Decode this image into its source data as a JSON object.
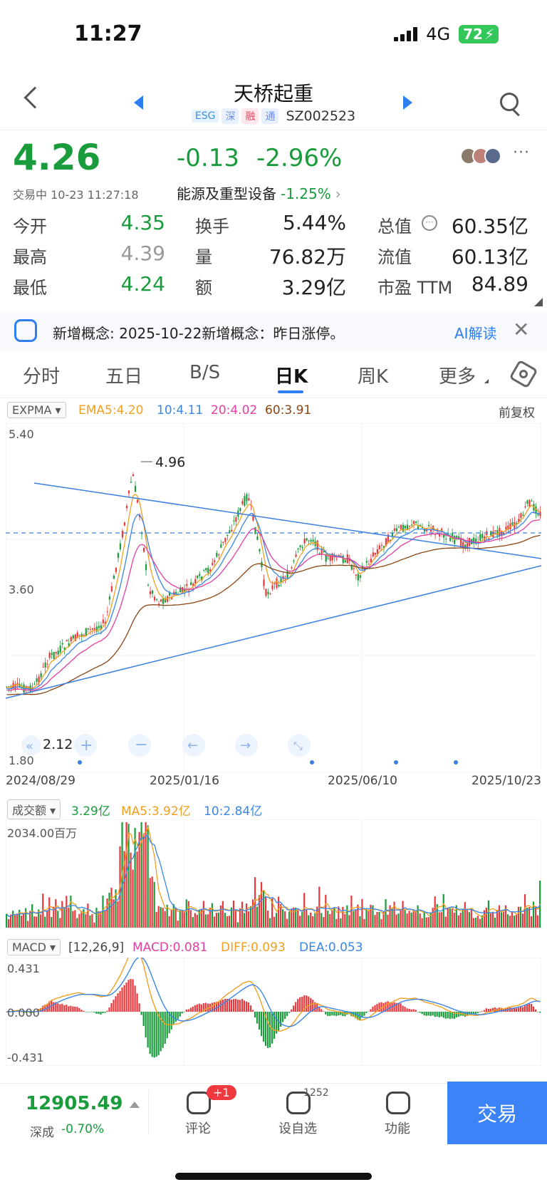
{
  "status_bar": {
    "time": "11:27",
    "network": "4G",
    "battery": "72"
  },
  "header": {
    "title": "天桥起重",
    "tags": [
      "ESG",
      "深",
      "融",
      "通"
    ],
    "code": "SZ002523"
  },
  "quote": {
    "price": "4.26",
    "change": "-0.13",
    "change_pct": "-2.96%",
    "trade_status": "交易中 10-23 11:27:18",
    "industry": "能源及重型设备",
    "industry_pct": "-1.25%",
    "more": "···",
    "stats": {
      "open_label": "今开",
      "open": "4.35",
      "high_label": "最高",
      "high": "4.39",
      "low_label": "最低",
      "low": "4.24",
      "turnover_label": "换手",
      "turnover": "5.44%",
      "volume_label": "量",
      "volume": "76.82万",
      "amount_label": "额",
      "amount": "3.29亿",
      "total_cap_label": "总值",
      "total_cap": "60.35亿",
      "float_cap_label": "流值",
      "float_cap": "60.13亿",
      "pe_label": "市盈 TTM",
      "pe": "84.89"
    }
  },
  "concept": {
    "text": "新增概念: 2025-10-22新增概念：昨日涨停。",
    "ai_label": "AI解读"
  },
  "tabs": [
    "分时",
    "五日",
    "B/S",
    "日K",
    "周K",
    "更多"
  ],
  "active_tab": "日K",
  "kline": {
    "indicator": "EXPMA",
    "ema5": "EMA5:4.20",
    "ema10": "10:4.11",
    "ema20": "20:4.02",
    "ema60": "60:3.91",
    "adjust": "前复权",
    "y_top": "5.40",
    "y_mid": "3.60",
    "y_bottom": "1.80",
    "max_label": "4.96",
    "min_label": "2.12",
    "dates": [
      "2024/08/29",
      "2025/01/16",
      "2025/06/10",
      "2025/10/23"
    ]
  },
  "volume_panel": {
    "indicator": "成交额",
    "value": "3.29亿",
    "ma5": "MA5:3.92亿",
    "ma10": "10:2.84亿",
    "y_top": "2034.00百万"
  },
  "macd_panel": {
    "indicator": "MACD",
    "params": "[12,26,9]",
    "macd": "MACD:0.081",
    "diff": "DIFF:0.093",
    "dea": "DEA:0.053",
    "y_top": "0.431",
    "y_mid": "0.000",
    "y_bottom": "-0.431"
  },
  "bottom_bar": {
    "index_value": "12905.49",
    "index_name": "深成",
    "index_pct": "-0.70%",
    "comment_label": "评论",
    "comment_badge": "+1",
    "watch_label": "设自选",
    "watch_count": "1252",
    "func_label": "功能",
    "trade_label": "交易"
  },
  "colors": {
    "up": "#e8383d",
    "down": "#1a9b3c",
    "accent": "#2f7ff0",
    "ema5": "#f0a020",
    "ema10": "#3a86e6",
    "ema20": "#e040a0",
    "ema60": "#8b4513"
  }
}
